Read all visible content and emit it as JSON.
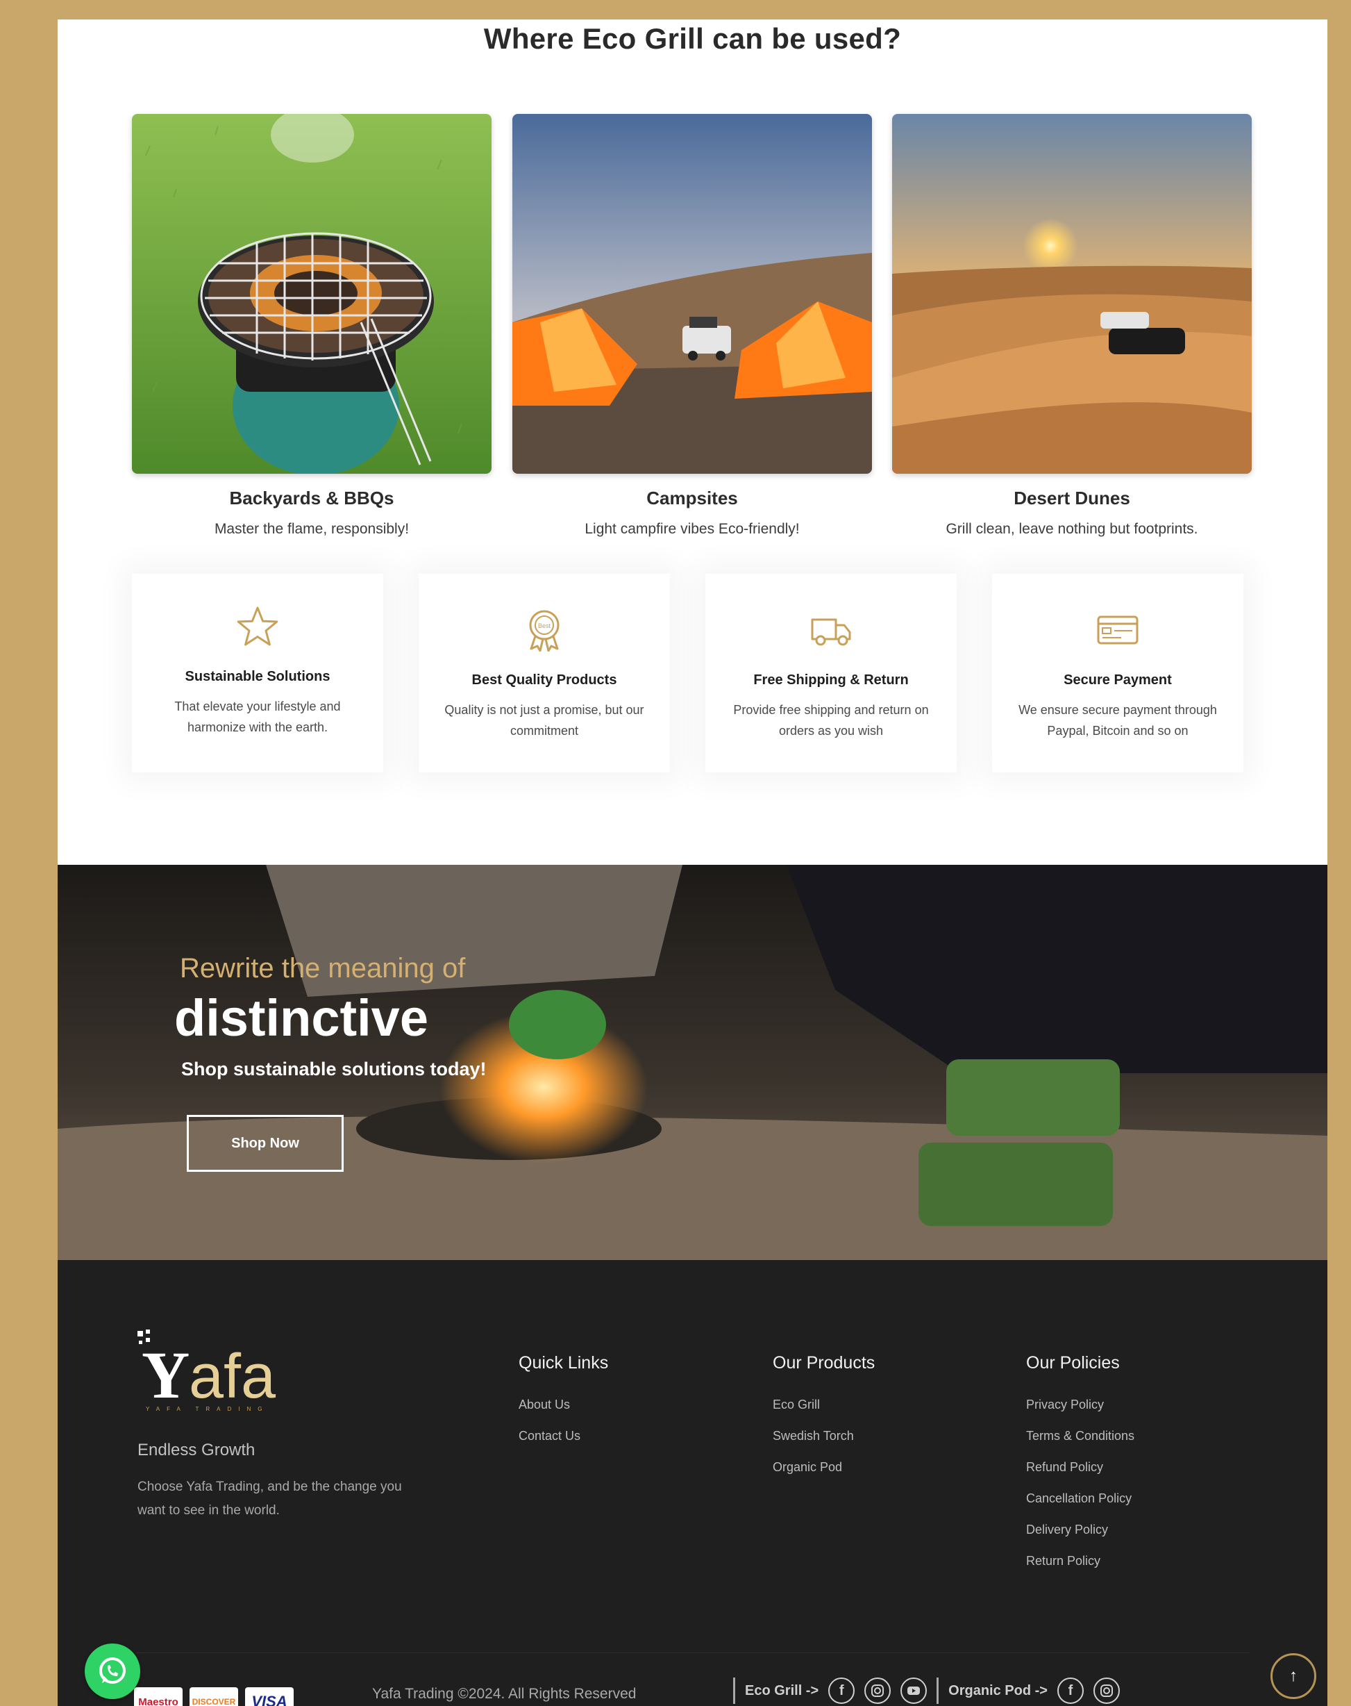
{
  "uses": {
    "title": "Where Eco Grill can be used?",
    "cards": [
      {
        "title": "Backyards & BBQs",
        "desc": "Master the flame, responsibly!"
      },
      {
        "title": "Campsites",
        "desc": "Light campfire vibes Eco-friendly!"
      },
      {
        "title": "Desert Dunes",
        "desc": "Grill clean, leave nothing but footprints."
      }
    ]
  },
  "features": [
    {
      "icon": "star-icon",
      "title": "Sustainable Solutions",
      "desc": "That elevate your lifestyle and harmonize with the earth."
    },
    {
      "icon": "badge-icon",
      "title": "Best Quality Products",
      "desc": "Quality is not just a promise, but our commitment"
    },
    {
      "icon": "truck-icon",
      "title": "Free Shipping & Return",
      "desc": "Provide free shipping and return on orders as you wish"
    },
    {
      "icon": "credit-card-icon",
      "title": "Secure Payment",
      "desc": "We ensure secure payment through Paypal, Bitcoin and so on"
    }
  ],
  "hero": {
    "kicker": "Rewrite the meaning of",
    "title": "distinctive",
    "subtitle": "Shop sustainable solutions today!",
    "button": "Shop Now"
  },
  "footer": {
    "logo_text": "Yafa",
    "logo_sub": "YAFA TRADING",
    "tagline": "Endless Growth",
    "about": "Choose Yafa Trading, and be the change you want to see in the world.",
    "columns": [
      {
        "title": "Quick Links",
        "links": [
          "About Us",
          "Contact Us"
        ]
      },
      {
        "title": "Our Products",
        "links": [
          "Eco Grill",
          "Swedish Torch",
          "Organic Pod"
        ]
      },
      {
        "title": "Our Policies",
        "links": [
          "Privacy Policy",
          "Terms & Conditions",
          "Refund Policy",
          "Cancellation Policy",
          "Delivery Policy",
          "Return Policy"
        ]
      }
    ],
    "payment_cards": [
      "Maestro",
      "DISCOVER",
      "VISA"
    ],
    "copyright": "Yafa Trading ©2024. All Rights Reserved",
    "social_eco_label": "Eco Grill ->",
    "social_pod_label": "Organic Pod ->"
  },
  "colors": {
    "accent": "#c9a76a",
    "footer_bg": "#1f1f1f",
    "icon_gold": "#c9a058"
  }
}
